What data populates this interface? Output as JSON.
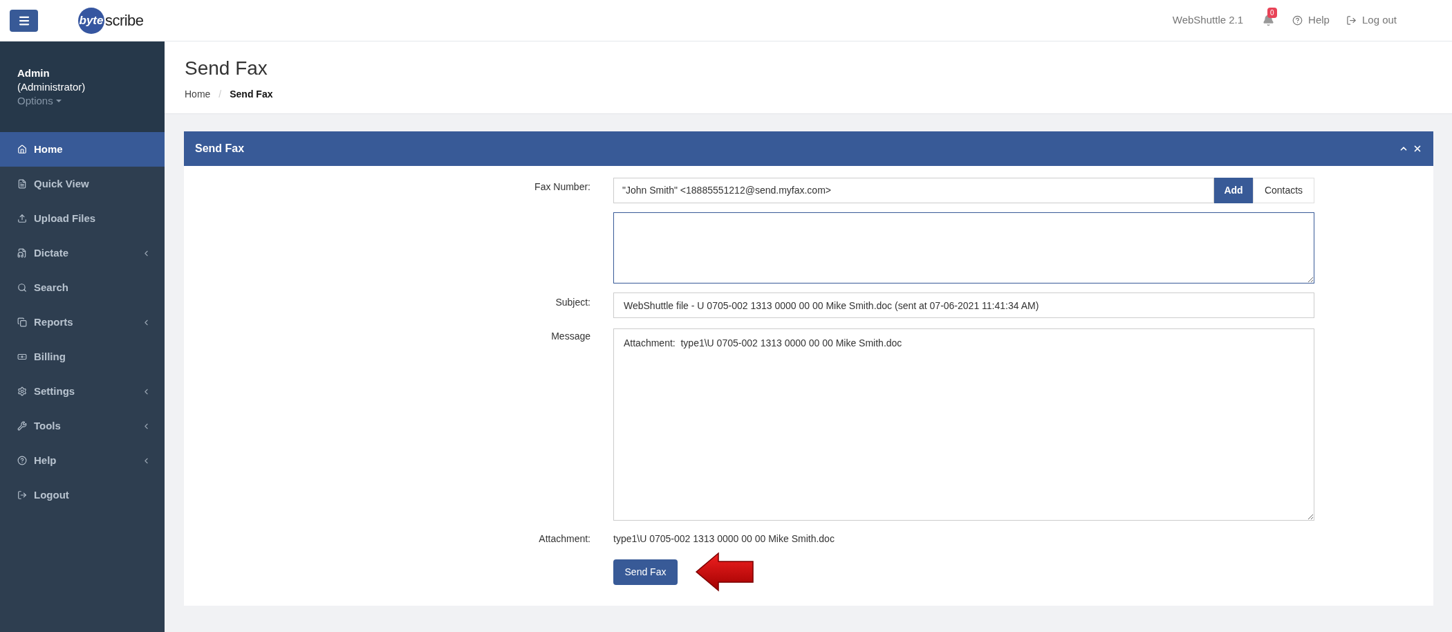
{
  "topbar": {
    "logo": {
      "mark": "byte",
      "text": "scribe"
    },
    "version": "WebShuttle 2.1",
    "notifications": "0",
    "links": [
      "Help",
      "Log out"
    ]
  },
  "user": {
    "name": "Admin",
    "role": "(Administrator)",
    "options": "Options"
  },
  "nav": [
    {
      "label": "Home",
      "selected": true,
      "submenu": false
    },
    {
      "label": "Quick View",
      "selected": false,
      "submenu": false
    },
    {
      "label": "Upload Files",
      "selected": false,
      "submenu": false
    },
    {
      "label": "Dictate",
      "selected": false,
      "submenu": true
    },
    {
      "label": "Search",
      "selected": false,
      "submenu": false
    },
    {
      "label": "Reports",
      "selected": false,
      "submenu": true
    },
    {
      "label": "Billing",
      "selected": false,
      "submenu": false
    },
    {
      "label": "Settings",
      "selected": false,
      "submenu": true
    },
    {
      "label": "Tools",
      "selected": false,
      "submenu": true
    },
    {
      "label": "Help",
      "selected": false,
      "submenu": true
    },
    {
      "label": "Logout",
      "selected": false,
      "submenu": false
    }
  ],
  "page": {
    "title": "Send Fax",
    "breadcrumb": [
      "Home",
      "/",
      "Send Fax"
    ]
  },
  "panel": {
    "title": "Send Fax",
    "fax_number": {
      "label": "Fax Number:",
      "value": "\"John Smith\" <18885551212@send.myfax.com>",
      "add": "Add",
      "contacts": "Contacts"
    },
    "subject": {
      "label": "Subject:",
      "value": "WebShuttle file - U 0705-002 1313 0000 00 00 Mike Smith.doc (sent at 07-06-2021 11:41:34 AM)"
    },
    "message": {
      "label": "Message",
      "value": "Attachment:  type1\\U 0705-002 1313 0000 00 00 Mike Smith.doc"
    },
    "attachment": {
      "label": "Attachment:",
      "value": "type1\\U 0705-002 1313 0000 00 00 Mike Smith.doc"
    },
    "submit": "Send Fax"
  }
}
